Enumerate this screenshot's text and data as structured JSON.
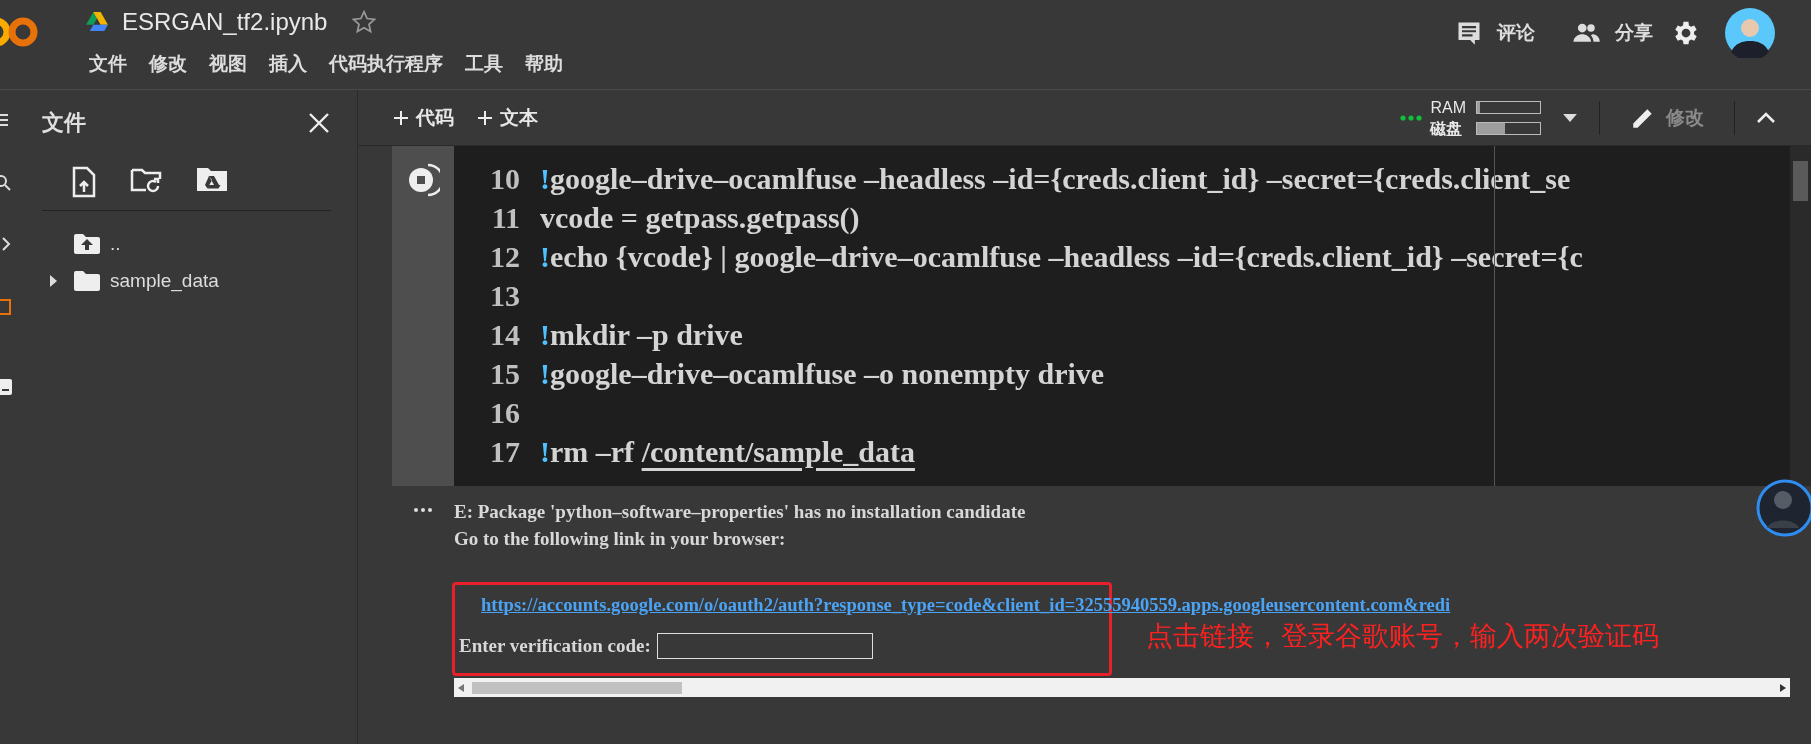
{
  "header": {
    "title": "ESRGAN_tf2.ipynb",
    "starred": false,
    "menu": [
      "文件",
      "修改",
      "视图",
      "插入",
      "代码执行程序",
      "工具",
      "帮助"
    ],
    "actions": [
      {
        "kind": "comment",
        "label": "评论"
      },
      {
        "kind": "share",
        "label": "分享"
      }
    ]
  },
  "toolbar": {
    "add_buttons": [
      "代码",
      "文本"
    ],
    "resources": [
      {
        "label": "RAM",
        "level": 0.04
      },
      {
        "label": "磁盘",
        "level": 0.45
      }
    ],
    "edit": {
      "label": "修改",
      "disabled": true
    }
  },
  "sidebar": {
    "title": "文件",
    "tree": [
      {
        "kind": "parent",
        "name": ".."
      },
      {
        "kind": "folder",
        "name": "sample_data",
        "expanded": false
      }
    ]
  },
  "cell": {
    "running": true,
    "lines": [
      {
        "number": "10",
        "parts": [
          {
            "kind": "bang",
            "text": "!"
          },
          {
            "kind": "plain",
            "text": "google–drive–ocamlfuse –headless –id={creds.client_id} –secret={creds.client_se"
          }
        ]
      },
      {
        "number": "11",
        "parts": [
          {
            "kind": "plain",
            "text": "vcode = getpass.getpass()"
          }
        ]
      },
      {
        "number": "12",
        "parts": [
          {
            "kind": "bang",
            "text": "!"
          },
          {
            "kind": "plain",
            "text": "echo {vcode} | google–drive–ocamlfuse –headless –id={creds.client_id} –secret={c"
          }
        ]
      },
      {
        "number": "13"
      },
      {
        "number": "14",
        "parts": [
          {
            "kind": "bang",
            "text": "!"
          },
          {
            "kind": "plain",
            "text": "mkdir –p drive"
          }
        ]
      },
      {
        "number": "15",
        "parts": [
          {
            "kind": "bang",
            "text": "!"
          },
          {
            "kind": "plain",
            "text": "google–drive–ocamlfuse –o nonempty drive"
          }
        ]
      },
      {
        "number": "16"
      },
      {
        "number": "17",
        "parts": [
          {
            "kind": "bang",
            "text": "!"
          },
          {
            "kind": "plain",
            "text": "rm –rf "
          },
          {
            "kind": "path",
            "text": "/content/sample_data"
          }
        ]
      }
    ]
  },
  "output": {
    "lines": [
      "E: Package 'python–software–properties' has no installation candidate",
      "Go to the following link in your browser:"
    ],
    "link": "https://accounts.google.com/o/oauth2/auth?response_type=code&client_id=32555940559.apps.googleusercontent.com&redi",
    "prompt": "Enter verification code:",
    "annotation": "点击链接，登录谷歌账号，输入两次验证码"
  }
}
